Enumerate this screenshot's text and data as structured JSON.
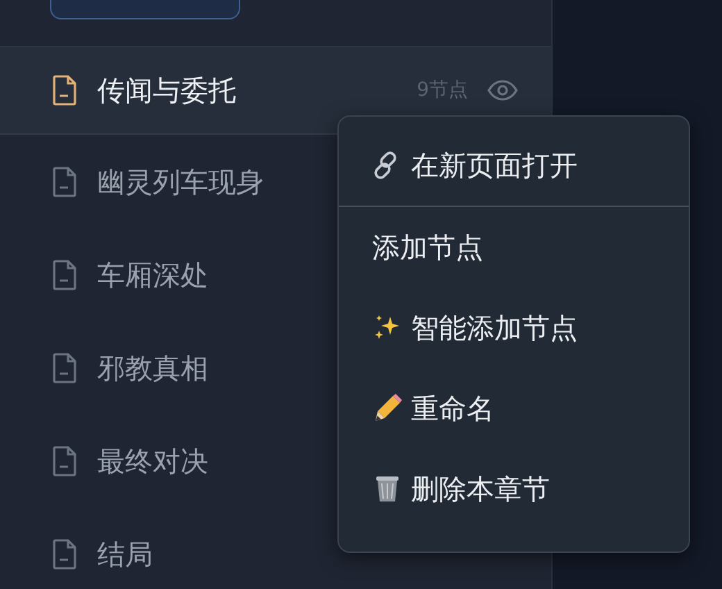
{
  "chapters": [
    {
      "title": "传闻与委托",
      "selected": true,
      "node_count": "9节点"
    },
    {
      "title": "幽灵列车现身",
      "selected": false
    },
    {
      "title": "车厢深处",
      "selected": false
    },
    {
      "title": "邪教真相",
      "selected": false
    },
    {
      "title": "最终对决",
      "selected": false
    },
    {
      "title": "结局",
      "selected": false
    }
  ],
  "context_menu": [
    {
      "kind": "open",
      "label": "在新页面打开",
      "divider_after": true
    },
    {
      "kind": "add",
      "label": "添加节点",
      "divider_after": false
    },
    {
      "kind": "smart-add",
      "label": "智能添加节点",
      "divider_after": false
    },
    {
      "kind": "rename",
      "label": "重命名",
      "divider_after": false
    },
    {
      "kind": "delete",
      "label": "删除本章节",
      "divider_after": false
    }
  ]
}
